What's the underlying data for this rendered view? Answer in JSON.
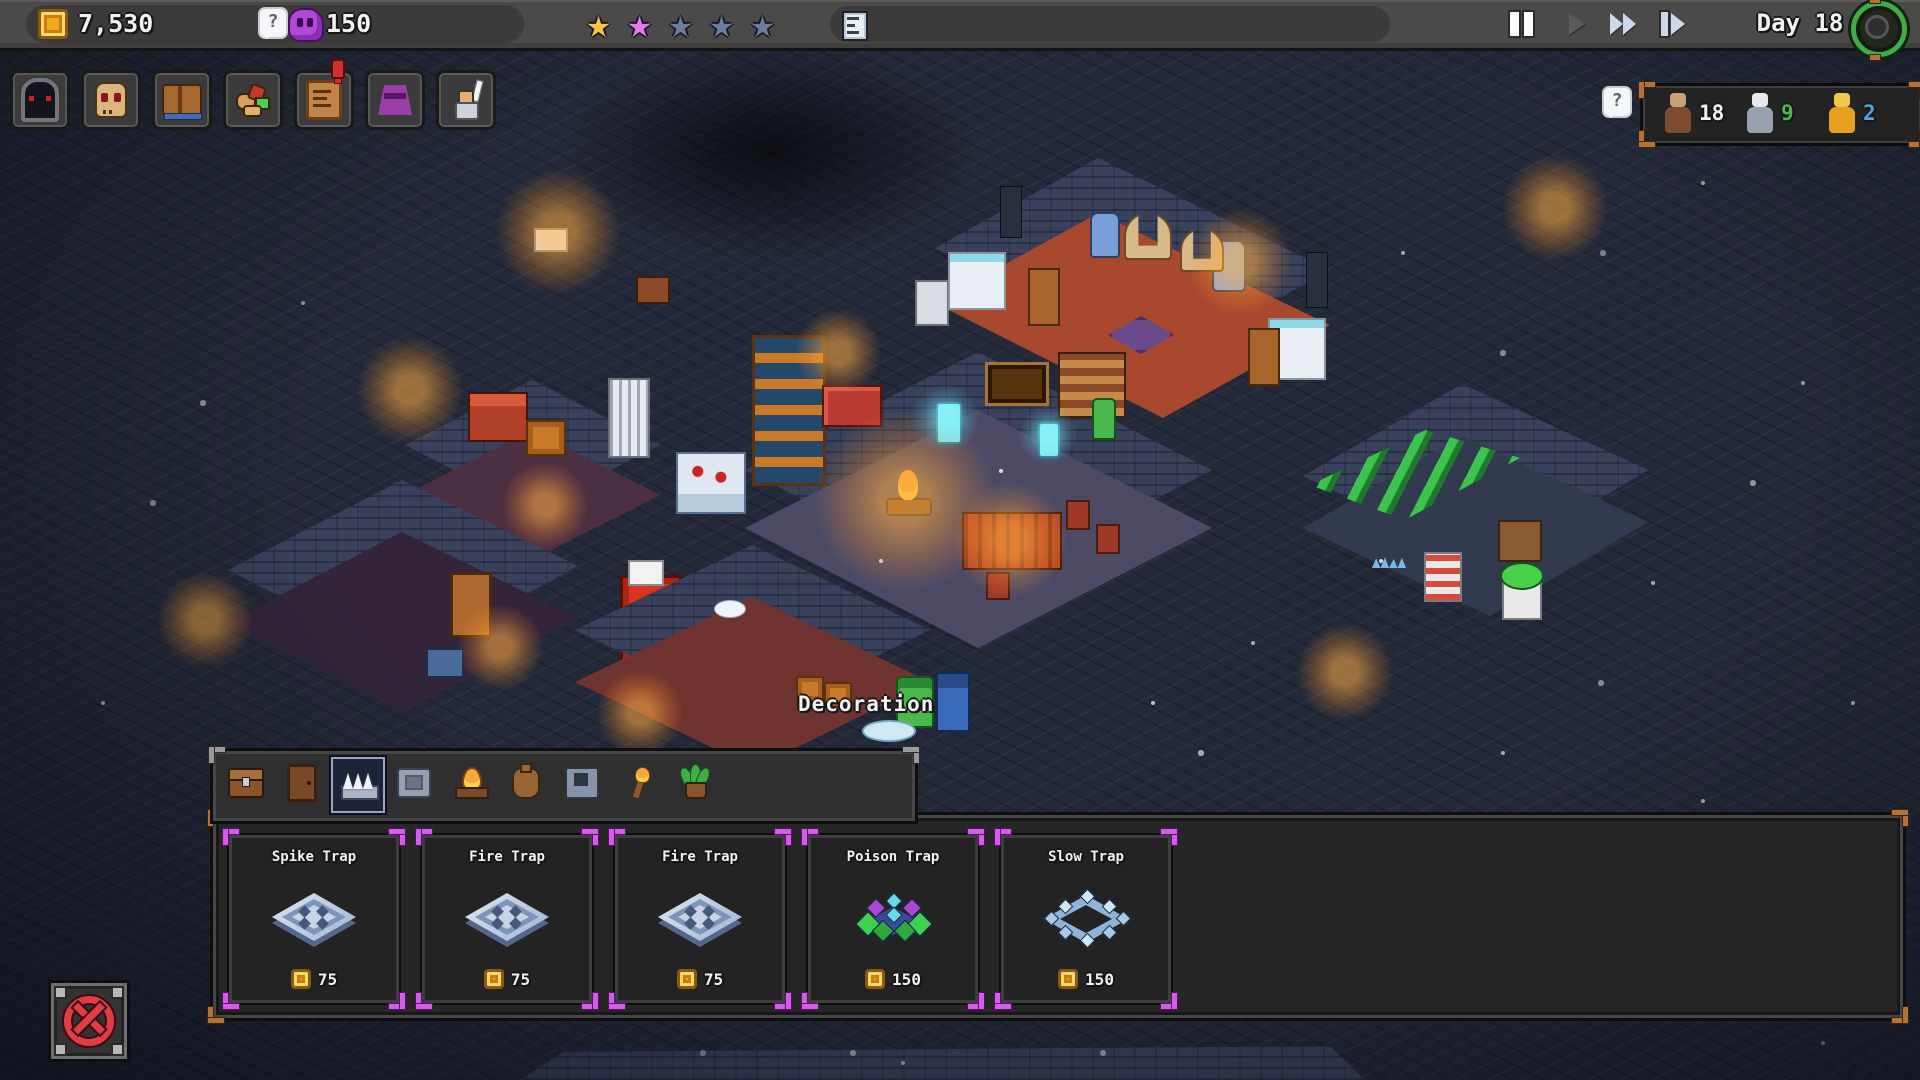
{
  "topbar": {
    "gold_amount": "7,530",
    "souls_amount": "150",
    "souls_hint": "?",
    "rating": {
      "filled_gold": 1,
      "filled_pink": 1,
      "empty": 3
    },
    "day_label": "Day 18"
  },
  "left_toolbar": {
    "buttons": [
      {
        "icon": "dungeon-gate"
      },
      {
        "icon": "skull"
      },
      {
        "icon": "journal-book"
      },
      {
        "icon": "supplies"
      },
      {
        "icon": "notice-scroll",
        "alert": true
      },
      {
        "icon": "demon-altar"
      },
      {
        "icon": "hero-statue"
      }
    ]
  },
  "population": {
    "hint": "?",
    "units": [
      {
        "type": "peasant",
        "count": "18",
        "count_color": "#f2f2f2"
      },
      {
        "type": "monk",
        "count": "9",
        "count_color": "#4db84d"
      },
      {
        "type": "knight",
        "count": "2",
        "count_color": "#4aa7e8"
      }
    ]
  },
  "viewport": {
    "tooltip": "Decoration"
  },
  "build_menu": {
    "tabs": [
      {
        "icon": "chest"
      },
      {
        "icon": "door"
      },
      {
        "icon": "spike-trap",
        "selected": true
      },
      {
        "icon": "pressure-plate"
      },
      {
        "icon": "campfire"
      },
      {
        "icon": "jug"
      },
      {
        "icon": "forge"
      },
      {
        "icon": "torch"
      },
      {
        "icon": "plant"
      }
    ],
    "items": [
      {
        "title": "Spike Trap",
        "cost": "75",
        "icon": "floor-plate"
      },
      {
        "title": "Fire Trap",
        "cost": "75",
        "icon": "floor-plate"
      },
      {
        "title": "Fire Trap",
        "cost": "75",
        "icon": "floor-plate"
      },
      {
        "title": "Poison Trap",
        "cost": "150",
        "icon": "poison-cluster"
      },
      {
        "title": "Slow Trap",
        "cost": "150",
        "icon": "ice-ring"
      }
    ]
  },
  "colors": {
    "star_gold": "#f6c445",
    "star_pink": "#e87ae8",
    "star_empty": "#6d7d9c",
    "bracket_magenta": "#d45ce8",
    "frame_bronze": "#b5713a",
    "settings_green": "#3fae46",
    "alert_red": "#d22f2f",
    "coin_gold": "#f3a81f"
  }
}
